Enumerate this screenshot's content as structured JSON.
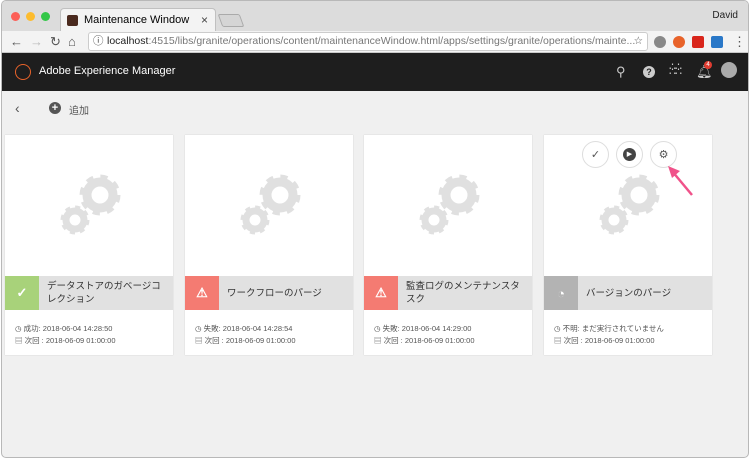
{
  "browser": {
    "tab_title": "Maintenance Window",
    "user": "David",
    "url_host": "localhost",
    "url_rest": ":4515/libs/granite/operations/content/maintenanceWindow.html/apps/settings/granite/operations/mainte..."
  },
  "header": {
    "brand": "Adobe Experience Manager",
    "notification_count": "4"
  },
  "toolbar": {
    "add_label": "追加"
  },
  "colors": {
    "success": "#a8d27a",
    "failure": "#f47b72",
    "unknown": "#b3b3b3"
  },
  "cards": [
    {
      "title": "データストアのガベージコレクション",
      "status": "success",
      "last": "成功: 2018-06-04 14:28:50",
      "next": "次回 : 2018-06-09 01:00:00"
    },
    {
      "title": "ワークフローのパージ",
      "status": "failure",
      "last": "失敗: 2018-06-04 14:28:54",
      "next": "次回 : 2018-06-09 01:00:00"
    },
    {
      "title": "監査ログのメンテナンスタスク",
      "status": "failure",
      "last": "失敗: 2018-06-04 14:29:00",
      "next": "次回 : 2018-06-09 01:00:00"
    },
    {
      "title": "バージョンのパージ",
      "status": "unknown",
      "last": "不明: まだ実行されていません",
      "next": "次回 : 2018-06-09 01:00:00"
    }
  ]
}
